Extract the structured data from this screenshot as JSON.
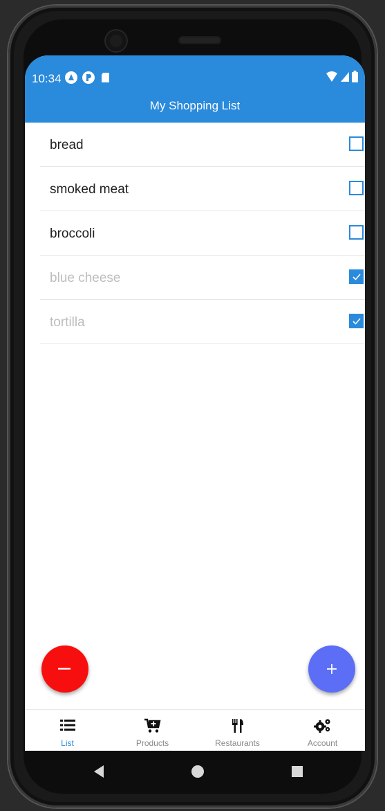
{
  "status_bar": {
    "time": "10:34"
  },
  "app_bar": {
    "title": "My Shopping List"
  },
  "items": [
    {
      "name": "bread",
      "checked": false
    },
    {
      "name": "smoked meat",
      "checked": false
    },
    {
      "name": "broccoli",
      "checked": false
    },
    {
      "name": "blue cheese",
      "checked": true
    },
    {
      "name": "tortilla",
      "checked": true
    }
  ],
  "fab": {
    "remove_symbol": "−",
    "add_symbol": "+"
  },
  "bottom_nav": {
    "items": [
      {
        "label": "List",
        "icon": "list-icon",
        "active": true
      },
      {
        "label": "Products",
        "icon": "cart-icon",
        "active": false
      },
      {
        "label": "Restaurants",
        "icon": "utensils-icon",
        "active": false
      },
      {
        "label": "Account",
        "icon": "gears-icon",
        "active": false
      }
    ]
  },
  "colors": {
    "primary": "#2a8adb",
    "remove_fab": "#f70f0f",
    "add_fab": "#5b6ef5",
    "checked_text": "#bdbdbd"
  }
}
